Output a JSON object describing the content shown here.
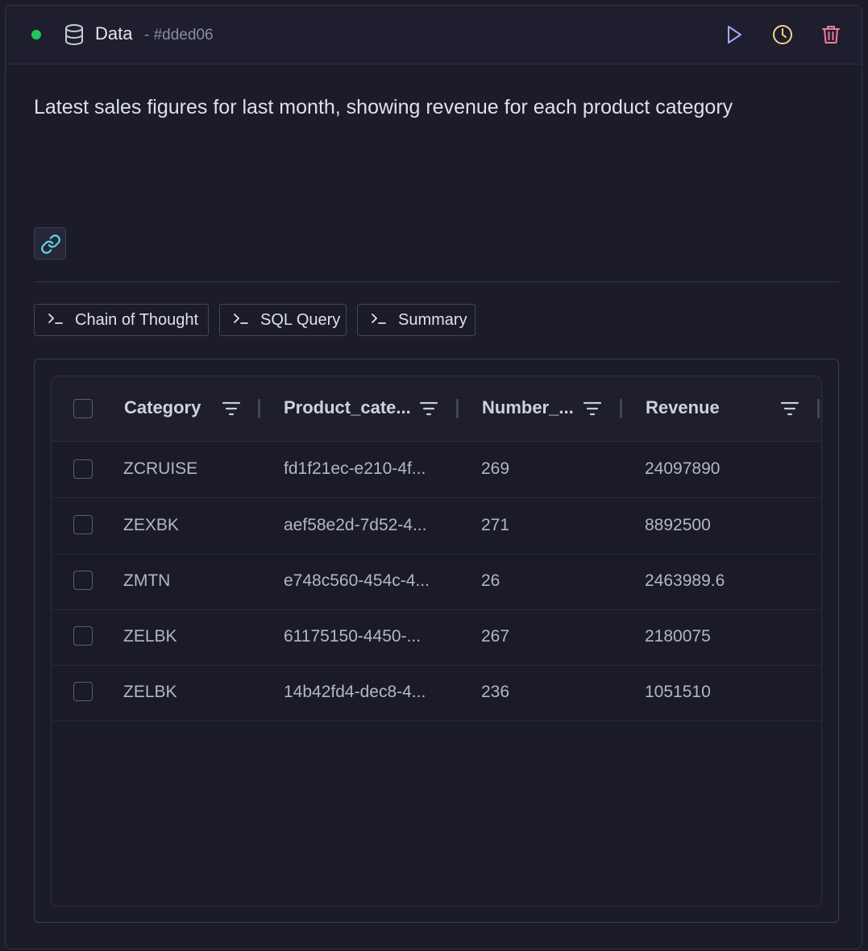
{
  "header": {
    "title": "Data",
    "subtitle": "- #dded06",
    "status_color": "#22c55e",
    "icons": {
      "database": "database-icon",
      "run": "play-icon",
      "schedule": "clock-icon",
      "delete": "trash-icon"
    }
  },
  "description": "Latest sales figures for last month, showing revenue for each product category",
  "tabs": [
    {
      "label": "Chain of Thought"
    },
    {
      "label": "SQL Query"
    },
    {
      "label": "Summary"
    }
  ],
  "table": {
    "columns": [
      "Category",
      "Product_cate...",
      "Number_...",
      "Revenue"
    ],
    "rows": [
      [
        "ZCRUISE",
        "fd1f21ec-e210-4f...",
        "269",
        "24097890"
      ],
      [
        "ZEXBK",
        "aef58e2d-7d52-4...",
        "271",
        "8892500"
      ],
      [
        "ZMTN",
        "e748c560-454c-4...",
        "26",
        "2463989.6"
      ],
      [
        "ZELBK",
        "61175150-4450-...",
        "267",
        "2180075"
      ],
      [
        "ZELBK",
        "14b42fd4-dec8-4...",
        "236",
        "1051510"
      ]
    ]
  },
  "colors": {
    "accent_play": "#a3a8ff",
    "accent_clock": "#f5d48b",
    "accent_delete": "#f47b9a",
    "link_icon": "#63d6e0"
  }
}
